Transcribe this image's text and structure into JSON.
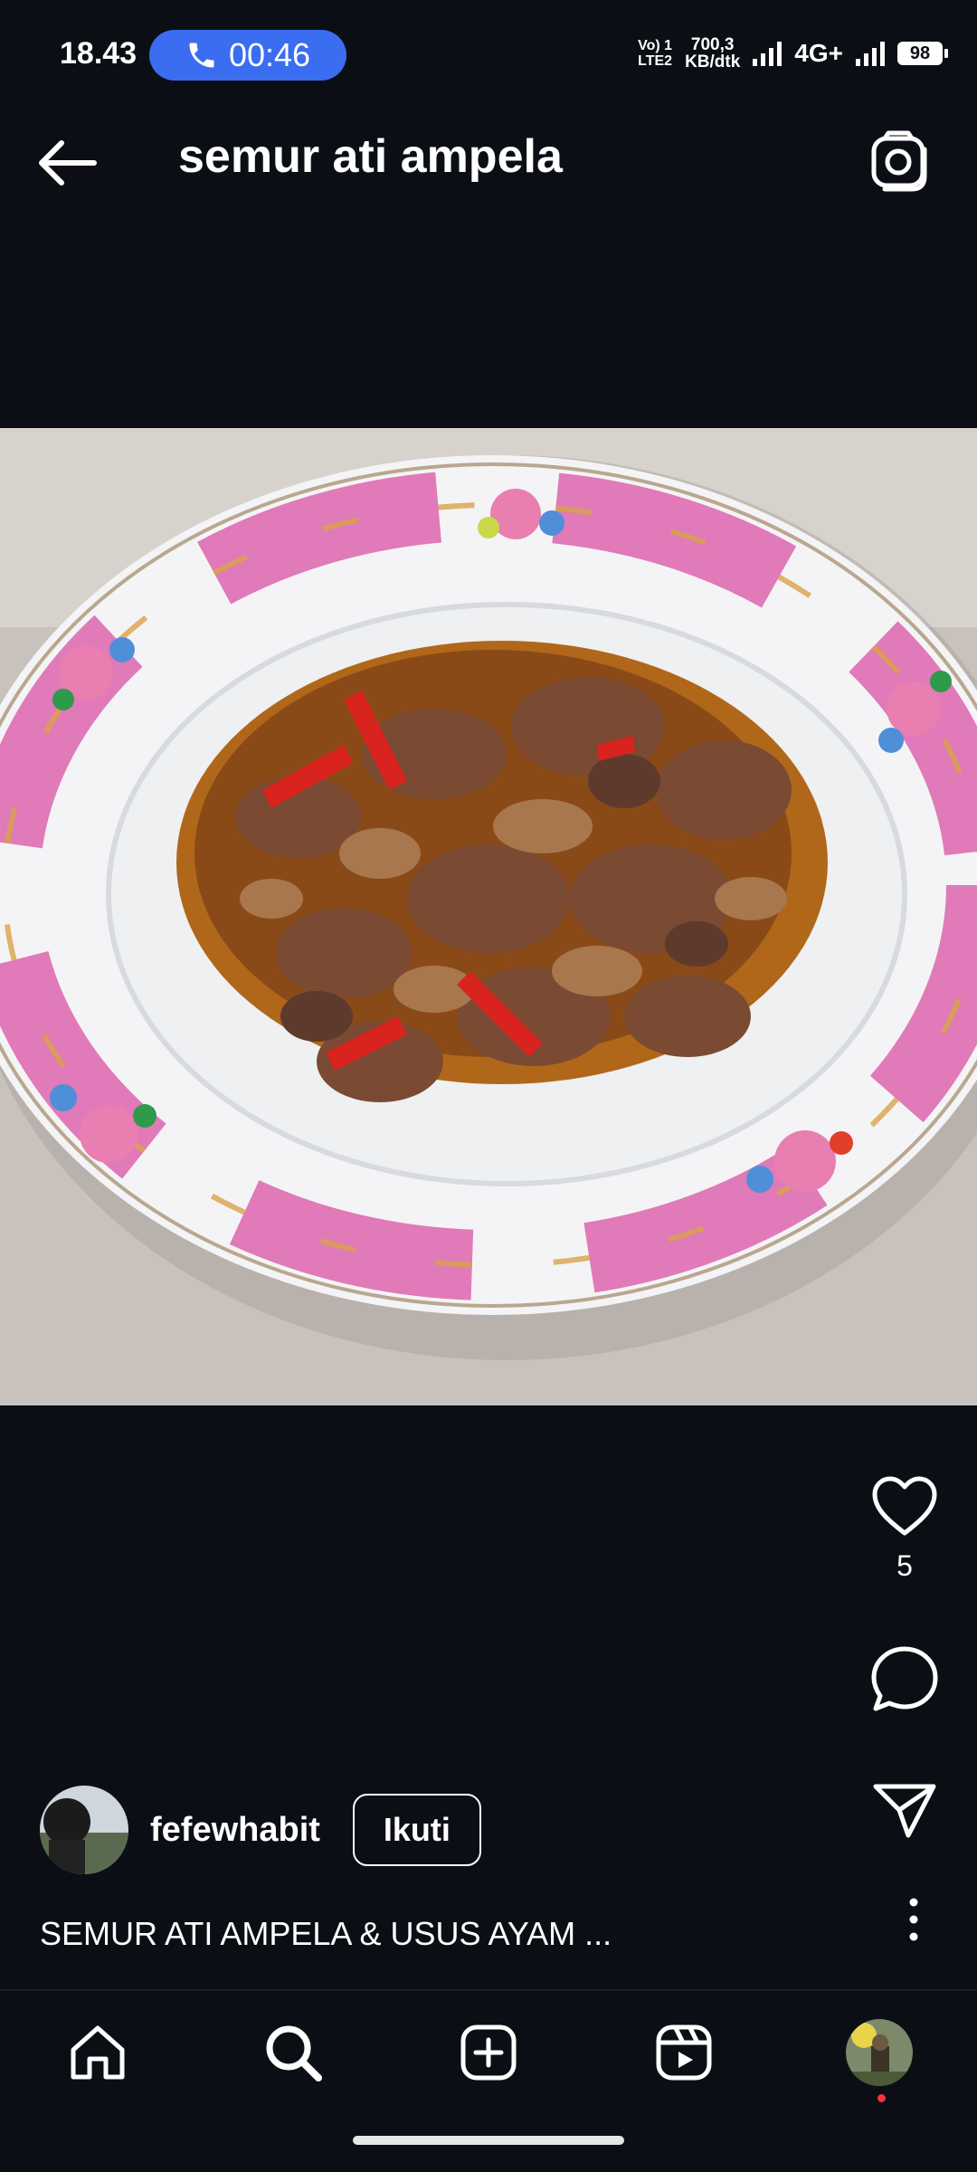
{
  "status_bar": {
    "time": "18.43",
    "call_timer": "00:46",
    "lte_line1": "Vo) 1",
    "lte_line2": "LTE2",
    "speed_line1": "700,3",
    "speed_line2": "KB/dtk",
    "network": "4G+",
    "battery": "98"
  },
  "header": {
    "title": "semur ati ampela",
    "back_icon": "arrow-left-icon",
    "camera_icon": "camera-icon"
  },
  "post": {
    "image_alt": "semur ati ampela",
    "like_count": "5",
    "username": "fefewhabit",
    "follow_label": "Ikuti",
    "caption": "SEMUR ATI AMPELA & USUS AYAM ..."
  },
  "nav": {
    "items": [
      "home-icon",
      "search-icon",
      "create-icon",
      "reels-icon",
      "profile-avatar"
    ]
  },
  "colors": {
    "background": "#0b0f15",
    "call_pill": "#3b6df0",
    "notification_dot": "#ff3040"
  }
}
